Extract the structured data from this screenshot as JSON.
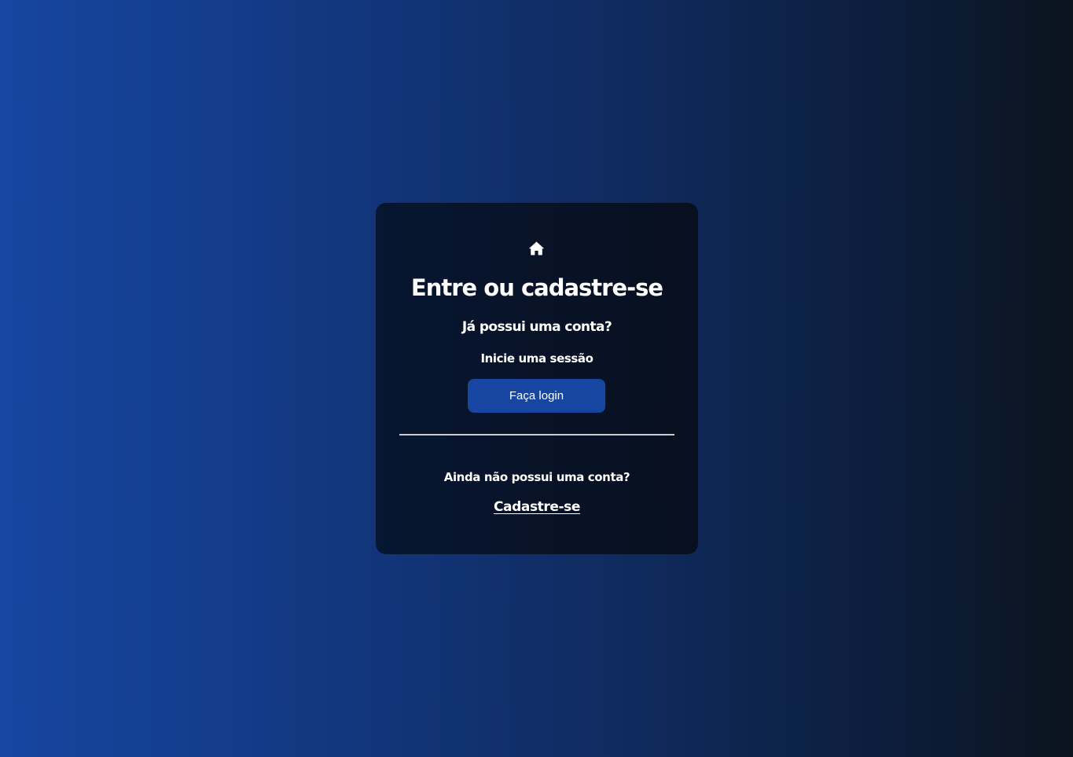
{
  "card": {
    "icon": "home-icon",
    "title": "Entre ou cadastre-se",
    "login_section": {
      "heading": "Já possui uma conta?",
      "text": "Inicie uma sessão",
      "button_label": "Faça login"
    },
    "signup_section": {
      "question": "Ainda não possui uma conta?",
      "link_label": "Cadastre-se"
    }
  },
  "colors": {
    "background_start": "#1646a1",
    "background_end": "#0b141e",
    "card_background": "#071631",
    "button_background": "#1646a1",
    "text": "#ffffff",
    "divider": "#c9ccd3"
  }
}
